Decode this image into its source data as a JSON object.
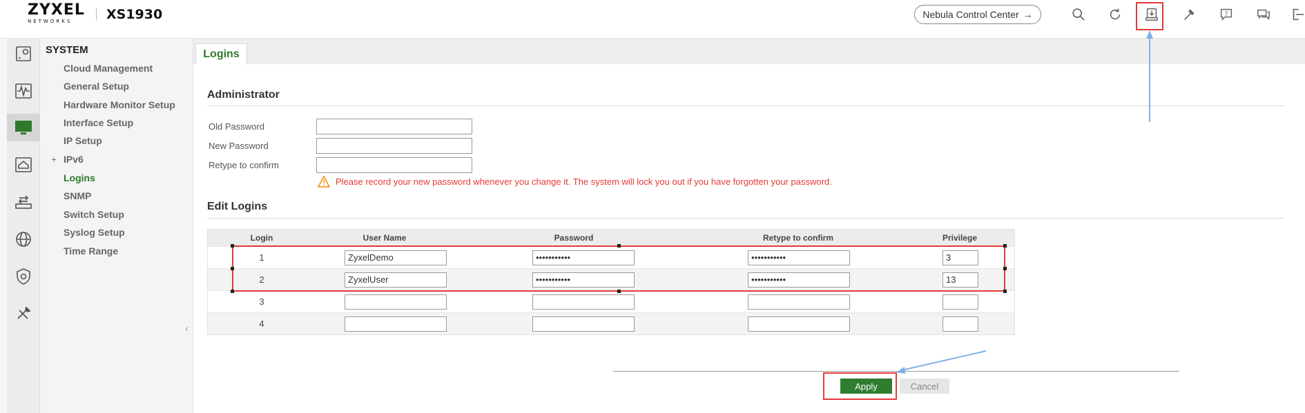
{
  "header": {
    "logo_word": "ZYXEL",
    "logo_sub": "NETWORKS",
    "model": "XS1930",
    "nebula_label": "Nebula Control Center",
    "nebula_arrow": "→",
    "icons": [
      "search-icon",
      "refresh-icon",
      "save-config-icon",
      "tools-icon",
      "help-icon",
      "feedback-icon",
      "logout-icon"
    ]
  },
  "rail": {
    "icons": [
      "dashboard-icon",
      "monitor-icon",
      "system-icon",
      "network-icon",
      "switching-icon",
      "routing-icon",
      "security-icon",
      "maintenance-icon"
    ],
    "active": "system-icon"
  },
  "sidebar": {
    "title": "SYSTEM",
    "items": [
      {
        "label": "Cloud Management"
      },
      {
        "label": "General Setup"
      },
      {
        "label": "Hardware Monitor Setup"
      },
      {
        "label": "Interface Setup"
      },
      {
        "label": "IP Setup"
      },
      {
        "label": "IPv6",
        "prefix": "+"
      },
      {
        "label": "Logins",
        "active": true
      },
      {
        "label": "SNMP"
      },
      {
        "label": "Switch Setup"
      },
      {
        "label": "Syslog Setup"
      },
      {
        "label": "Time Range"
      }
    ],
    "collapse": "‹"
  },
  "tab": {
    "label": "Logins"
  },
  "admin": {
    "title": "Administrator",
    "old_password_label": "Old Password",
    "new_password_label": "New Password",
    "retype_label": "Retype to confirm",
    "warning": "Please record your new password whenever you change it. The system will lock you out if you have forgotten your password."
  },
  "edit_logins": {
    "title": "Edit Logins",
    "columns": {
      "login": "Login",
      "user_name": "User Name",
      "password": "Password",
      "retype": "Retype to confirm",
      "privilege": "Privilege"
    },
    "rows": [
      {
        "login": "1",
        "user_name": "ZyxelDemo",
        "password": "•••••••••••",
        "retype": "•••••••••••",
        "privilege": "3"
      },
      {
        "login": "2",
        "user_name": "ZyxelUser",
        "password": "•••••••••••",
        "retype": "•••••••••••",
        "privilege": "13"
      },
      {
        "login": "3",
        "user_name": "",
        "password": "",
        "retype": "",
        "privilege": ""
      },
      {
        "login": "4",
        "user_name": "",
        "password": "",
        "retype": "",
        "privilege": ""
      }
    ]
  },
  "actions": {
    "apply": "Apply",
    "cancel": "Cancel"
  },
  "colors": {
    "accent": "#2d7a2d",
    "highlight": "#e23a3a",
    "arrow": "#7fb0e8",
    "warning": "#e53935"
  }
}
